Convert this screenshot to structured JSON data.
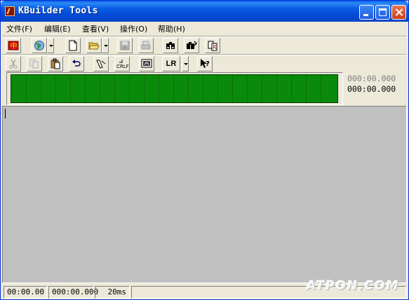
{
  "window": {
    "title": "KBuilder Tools"
  },
  "menu": {
    "items": [
      "文件(F)",
      "编辑(E)",
      "查看(V)",
      "操作(O)",
      "帮助(H)"
    ]
  },
  "toolbar1": {
    "icons": [
      "cn-flag-icon",
      "disc-icon",
      "new-document-icon",
      "open-folder-icon",
      "save-icon",
      "print-icon",
      "find-icon",
      "find-next-icon",
      "replace-icon"
    ]
  },
  "toolbar2": {
    "icons": [
      "cut-icon",
      "copy-icon",
      "paste-icon",
      "undo-icon",
      "edit-pen-icon",
      "crlf-icon",
      "monitor-icon",
      "context-help-icon"
    ],
    "lr_label": "LR"
  },
  "time": {
    "top": "000:00.000",
    "bottom": "000:00.000"
  },
  "status": {
    "panel1": "00:00.00",
    "panel2": "000:00.000",
    "panel3": "20ms"
  },
  "watermark": "ATPON.COM",
  "colors": {
    "title_bar": "#0a5fe6",
    "wave_green": "#0a8a0a",
    "content_gray": "#c0c0c0",
    "chrome": "#ece9d8"
  }
}
